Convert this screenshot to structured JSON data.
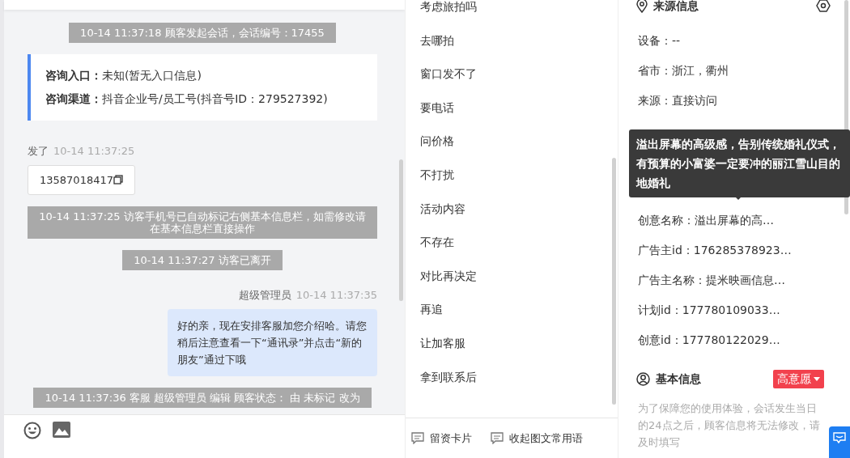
{
  "chat": {
    "messages": [
      {
        "kind": "system",
        "text": "10-14 11:37:18 顾客发起会话，会话编号：17455"
      },
      {
        "kind": "info",
        "lines": [
          {
            "label": "咨询入口：",
            "value": "未知(暂无入口信息)"
          },
          {
            "label": "咨询渠道：",
            "value": "抖音企业号/员工号(抖音号ID：279527392)"
          }
        ]
      },
      {
        "kind": "visitor",
        "sender": "发了",
        "time": "10-14 11:37:25",
        "text": "13587018417"
      },
      {
        "kind": "system",
        "text": "10-14 11:37:25 访客手机号已自动标记右侧基本信息栏，如需修改请在基本信息栏直接操作"
      },
      {
        "kind": "system",
        "text": "10-14 11:37:27 访客已离开"
      },
      {
        "kind": "agent",
        "sender": "超级管理员",
        "time": "10-14 11:37:35",
        "text": "好的亲，现在安排客服加您介绍哈。请您稍后注意查看一下“通讯录”并点击“新的朋友”通过下哦"
      },
      {
        "kind": "system",
        "text": "10-14 11:37:36 客服 超级管理员 编辑 顾客状态： 由 未标记 改为"
      }
    ]
  },
  "phrases": {
    "items": [
      "考虑旅拍吗",
      "去哪拍",
      "窗口发不了",
      "要电话",
      "问价格",
      "不打扰",
      "活动内容",
      "不存在",
      "对比再决定",
      "再追",
      "让加客服",
      "拿到联系后"
    ],
    "footer": [
      "留资卡片",
      "收起图文常用语"
    ]
  },
  "source_info": {
    "title": "来源信息",
    "rows": [
      "设备：--",
      "省市：浙江，衢州",
      "来源：直接访问",
      "创意名称：溢出屏幕的高…",
      "广告主id：176285378923…",
      "广告主名称：提米映画信息…",
      "计划id：177780109033…",
      "创意id：177780122029…"
    ],
    "tooltip": "溢出屏幕的高级感，告别传统婚礼仪式，有预算的小富婆一定要冲的丽江雪山目的地婚礼"
  },
  "basic_info": {
    "title": "基本信息",
    "status": "高意愿",
    "notice": "为了保障您的使用体验，会话发生当日的24点之后，顾客信息将无法修改，请及时填写"
  }
}
